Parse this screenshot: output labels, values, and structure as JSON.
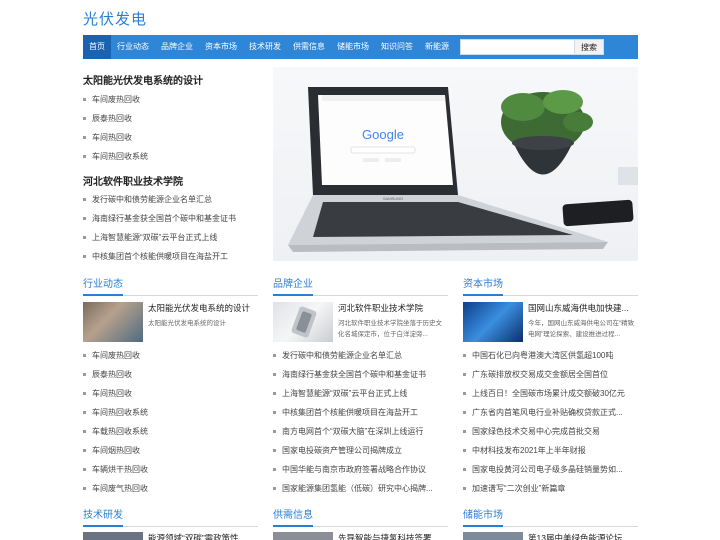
{
  "site": {
    "title": "光伏发电"
  },
  "nav": {
    "items": [
      "首页",
      "行业动态",
      "品牌企业",
      "资本市场",
      "技术研发",
      "供需信息",
      "储能市场",
      "知识问答",
      "新能源"
    ],
    "search_button": "搜索",
    "search_placeholder": ""
  },
  "top_left": {
    "title1": "太阳能光伏发电系统的设计",
    "list1": [
      "车间废热回收",
      "辰泰热回收",
      "车间热回收",
      "车间热回收系统"
    ],
    "title2": "河北软件职业技术学院",
    "list2": [
      "发行碳中和债劳能源企业名单汇总",
      "海南绿行基金获全国首个碳中和基金证书",
      "上海智慧能源“双碳”云平台正式上线",
      "中核集团首个核能供暖项目在海盐开工"
    ]
  },
  "hero": {
    "brand": "Google",
    "laptop_brand": "SAMSUNG"
  },
  "sections": [
    {
      "title": "行业动态",
      "feature": {
        "title": "太阳能光伏发电系统的设计",
        "desc": "太阳能光伏发电系统的设计"
      },
      "items": [
        "车间废热回收",
        "辰泰热回收",
        "车间热回收",
        "车间热回收系统",
        "车载热回收系统",
        "车间烟热回收",
        "车辆烘干热回收",
        "车间废气热回收"
      ]
    },
    {
      "title": "品牌企业",
      "feature": {
        "title": "河北软件职业技术学院",
        "desc": "河北软件职业技术学院坐落于历史文化名城保定市，位于白洋淀旁..."
      },
      "items": [
        "发行碳中和债劳能源企业名单汇总",
        "海南绿行基金获全国首个碳中和基金证书",
        "上海智慧能源“双碳”云平台正式上线",
        "中核集团首个核能供暖项目在海盐开工",
        "南方电网首个“双碳大脑”在深圳上线运行",
        "国家电投碳资产管理公司揭牌成立",
        "中国华能与南京市政府签署战略合作协议",
        "国家能源集团氢能（低碳）研究中心揭牌..."
      ]
    },
    {
      "title": "资本市场",
      "feature": {
        "title": "国网山东威海供电加快建...",
        "desc": "今年，国网山东威海供电公司在“精致电网”理论探索、建设推进过程..."
      },
      "items": [
        "中国石化已向粤港澳大湾区供氢超100吨",
        "广东碳排放权交易成交金额居全国首位",
        "上线百日！全国碳市场累计成交额破30亿元",
        "广东省内首笔风电行业补贴确权贷款正式...",
        "国家绿色技术交易中心完成首批交易",
        "中材科技发布2021年上半年财报",
        "国家电投黄河公司电子级多晶硅销量势如...",
        "加速谱写“二次创业”新篇章"
      ]
    }
  ],
  "bottom_sections": [
    {
      "title": "技术研发",
      "peek": "能源领域“双碳”需政策性..."
    },
    {
      "title": "供需信息",
      "peek": "先导智能与捷氢科技签署..."
    },
    {
      "title": "储能市场",
      "peek": "第13届中美绿色能源论坛..."
    }
  ]
}
